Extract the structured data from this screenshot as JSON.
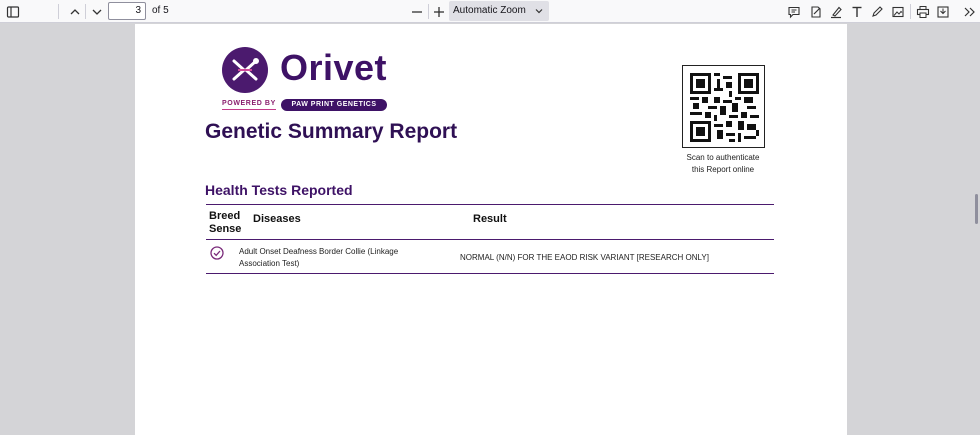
{
  "toolbar": {
    "page_number": "3",
    "page_count": "of 5",
    "zoom": "Automatic Zoom"
  },
  "document": {
    "brand": "Orivet",
    "powered_by": "POWERED BY",
    "partner": "PAW PRINT GENETICS",
    "title": "Genetic Summary Report",
    "qr_caption_line1": "Scan to authenticate",
    "qr_caption_line2": "this Report online",
    "section_title": "Health Tests Reported",
    "table": {
      "headers": {
        "breed_sense_1": "Breed",
        "breed_sense_2": "Sense",
        "diseases": "Diseases",
        "result": "Result"
      },
      "rows": [
        {
          "disease_line1": "Adult Onset Deafness Border Collie (Linkage",
          "disease_line2": "Association Test)",
          "result": "NORMAL (N/N) FOR THE EAOD RISK VARIANT [RESEARCH ONLY]"
        }
      ]
    }
  },
  "colors": {
    "brand_purple": "#3e1266",
    "accent_pink": "#c43b8b"
  }
}
